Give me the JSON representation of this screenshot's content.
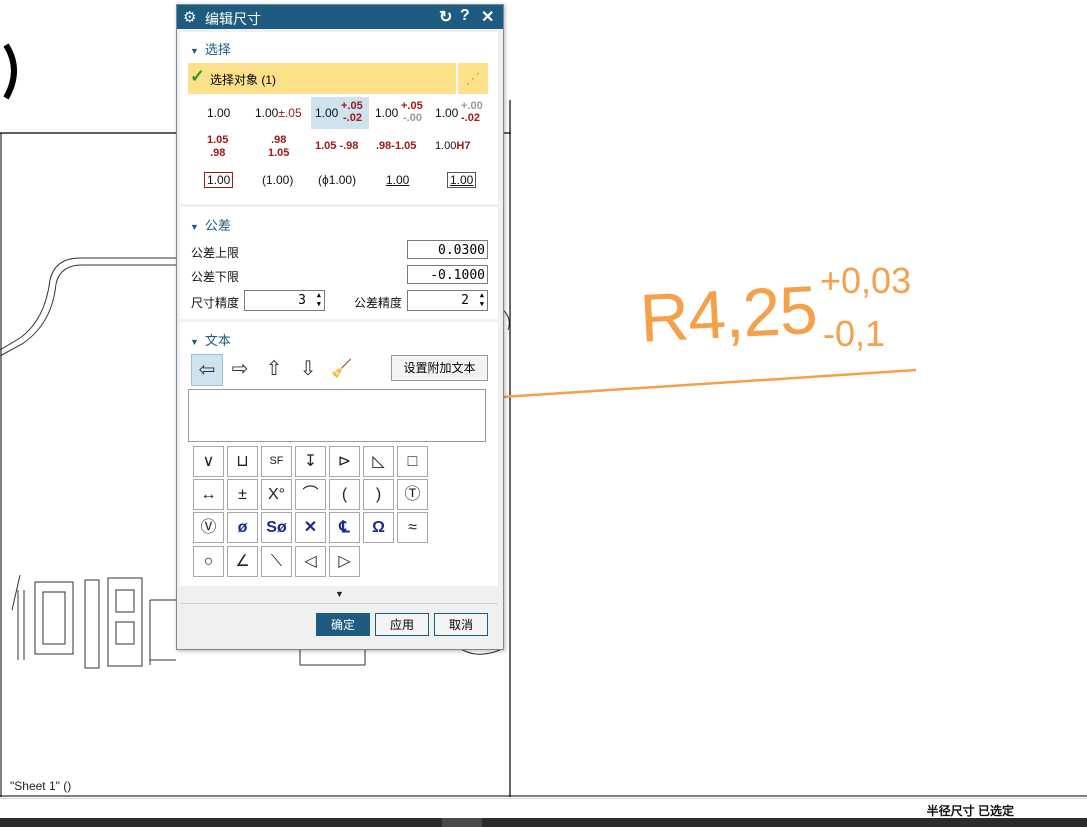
{
  "canvas": {
    "dimension_value": "R4,25",
    "tolerance_upper": "+0,03",
    "tolerance_lower": "-0,1",
    "sheet_label": "\"Sheet 1\"  ()",
    "annotation_color": "#f5a04a"
  },
  "status": {
    "text": "半径尺寸 已选定"
  },
  "dialog": {
    "title": "编辑尺寸",
    "reset_glyph": "↻",
    "help_glyph": "?",
    "close_glyph": "✕",
    "sections": {
      "select": "选择",
      "tolerance": "公差",
      "text": "文本"
    },
    "select_object": "选择对象 (1)",
    "formats": {
      "r1": {
        "f1": "1.00",
        "f2_base": "1.00",
        "f2_tol": "±.05",
        "f3_base": "1.00",
        "f3_up": "+.05",
        "f3_lo": "-.02",
        "f4_base": "1.00",
        "f4_up": "+.05",
        "f4_lo": "-.00",
        "f5_base": "1.00",
        "f5_up": "+.00",
        "f5_lo": "-.02"
      },
      "r2": {
        "f1_top": "1.05",
        "f1_bot": ".98",
        "f2_top": ".98",
        "f2_bot": "1.05",
        "f3": "1.05 -.98",
        "f4": ".98-1.05",
        "f5_base": "1.00",
        "f5_fit": "H7"
      },
      "r3": {
        "f1": "1.00",
        "f2": "(1.00)",
        "f3": "(ϕ1.00)",
        "f4": "1.00",
        "f5": "1.00"
      }
    },
    "tolerance": {
      "upper_label": "公差上限",
      "upper_value": "0.0300",
      "lower_label": "公差下限",
      "lower_value": "-0.1000",
      "precision_label": "尺寸精度",
      "precision_value": "3",
      "tol_precision_label": "公差精度",
      "tol_precision_value": "2"
    },
    "text": {
      "set_additional_text": "设置附加文本",
      "arrow_before": "⇦",
      "arrow_after": "⇨",
      "arrow_above": "⇧",
      "arrow_below": "⇩",
      "clear_glyph": "🧹",
      "symbols_row1": [
        "∨",
        "⊔",
        "SF",
        "↧",
        "⊳",
        "◺",
        "□"
      ],
      "symbols_row2": [
        "↔",
        "±",
        "X°",
        "⌒",
        "(",
        ")",
        "Ⓣ"
      ],
      "symbols_row3": [
        "Ⓥ",
        "ø",
        "Sø",
        "✕",
        "℄",
        "Ω",
        "≈"
      ],
      "symbols_row4": [
        "○",
        "∠",
        "⟍",
        "◁",
        "▷"
      ]
    },
    "expand_glyph": "▼",
    "buttons": {
      "ok": "确定",
      "apply": "应用",
      "cancel": "取消"
    }
  }
}
